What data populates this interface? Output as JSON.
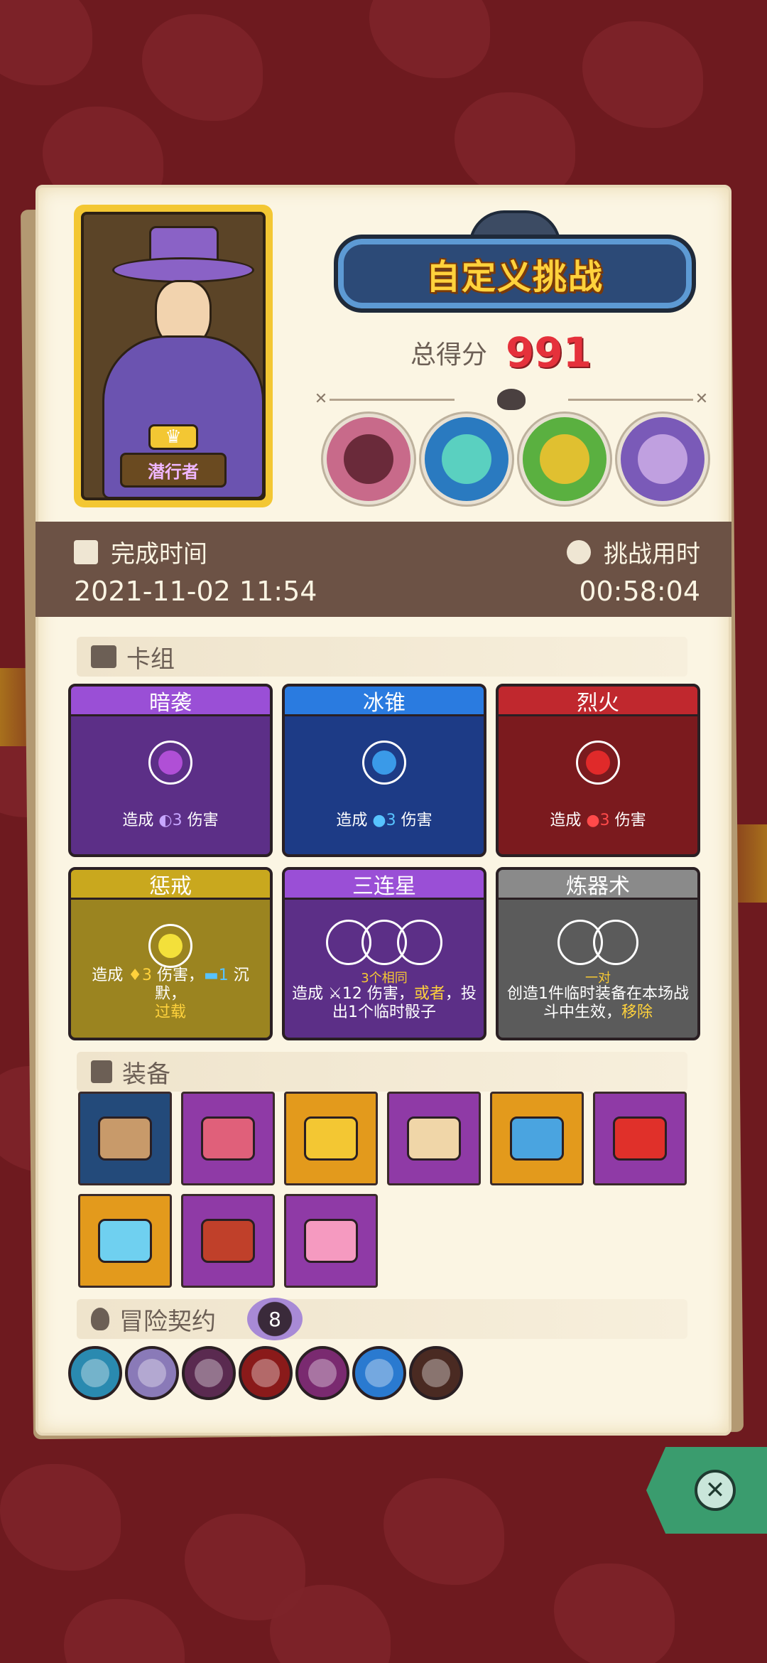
{
  "portrait": {
    "name": "潜行者"
  },
  "header": {
    "title": "自定义挑战",
    "score_label": "总得分",
    "score_value": "991"
  },
  "time": {
    "finish_label": "完成时间",
    "finish_value": "2021-11-02 11:54",
    "duration_label": "挑战用时",
    "duration_value": "00:58:04"
  },
  "deck": {
    "section_label": "卡组",
    "cards": [
      {
        "name": "暗袭",
        "desc_pre": "造成 ",
        "desc_num": "3",
        "desc_post": " 伤害"
      },
      {
        "name": "冰锥",
        "desc_pre": "造成 ",
        "desc_num": "3",
        "desc_post": " 伤害"
      },
      {
        "name": "烈火",
        "desc_pre": "造成 ",
        "desc_num": "3",
        "desc_post": " 伤害"
      },
      {
        "name": "惩戒",
        "desc_pre": "造成 ",
        "desc_num": "3",
        "desc_mid": " 伤害，",
        "desc_num2": "1",
        "desc_mid2": " 沉默，",
        "desc_hl": "过载"
      },
      {
        "name": "三连星",
        "ring_label": "3个相同",
        "desc_pre": "造成 ",
        "desc_num": "12",
        "desc_mid": " 伤害，",
        "desc_hl": "或者",
        "desc_post": "，投出1个临时骰子"
      },
      {
        "name": "炼器术",
        "ring_label": "一对",
        "desc_pre": "创造1件临时装备在本场战斗中生效，",
        "desc_hl": "移除"
      }
    ]
  },
  "equipment": {
    "section_label": "装备",
    "items": [
      {
        "icon": "horn-icon",
        "bg": "#234a7a",
        "color": "#c89a6a"
      },
      {
        "icon": "dripping-slime-icon",
        "bg": "#8f3aa6",
        "color": "#e0607a"
      },
      {
        "icon": "crown-icon",
        "bg": "#e39a1c",
        "color": "#f3c733"
      },
      {
        "icon": "spiked-dice-icon",
        "bg": "#8f3aa6",
        "color": "#f0d6a8"
      },
      {
        "icon": "potion-bottle-icon",
        "bg": "#e39a1c",
        "color": "#4aa4e0"
      },
      {
        "icon": "flaming-dagger-icon",
        "bg": "#8f3aa6",
        "color": "#e0302a"
      },
      {
        "icon": "ice-shield-icon",
        "bg": "#e39a1c",
        "color": "#6fd0f0"
      },
      {
        "icon": "spiked-bracer-icon",
        "bg": "#8f3aa6",
        "color": "#c0402a"
      },
      {
        "icon": "heart-amulet-icon",
        "bg": "#8f3aa6",
        "color": "#f59ac0"
      }
    ]
  },
  "contracts": {
    "section_label": "冒险契约",
    "count": "8",
    "items": [
      {
        "icon": "lightning-contract-icon",
        "color": "#2a8ab0"
      },
      {
        "icon": "swords-contract-icon",
        "color": "#8a7ab8"
      },
      {
        "icon": "fire-burst-contract-icon",
        "color": "#5a2a50"
      },
      {
        "icon": "red-rune-contract-icon",
        "color": "#8a1a1a"
      },
      {
        "icon": "poison-flask-contract-icon",
        "color": "#7a2a70"
      },
      {
        "icon": "vortex-contract-icon",
        "color": "#2a7ad0"
      },
      {
        "icon": "pipe-contract-icon",
        "color": "#4a2a22"
      }
    ]
  },
  "bosses": [
    {
      "icon": "stone-golem-boss-icon",
      "bg": "#c86a8a",
      "core": "#6a2a3a"
    },
    {
      "icon": "ice-king-boss-icon",
      "bg": "#2a7ac0",
      "core": "#5ad0c0"
    },
    {
      "icon": "goblin-king-boss-icon",
      "bg": "#5ab040",
      "core": "#e0c030"
    },
    {
      "icon": "purple-dragon-boss-icon",
      "bg": "#7a5ab8",
      "core": "#c0a0e0"
    }
  ],
  "colors": {
    "purple_card": "#5c2f87",
    "purple_head": "#9a4fd6",
    "blue_card": "#1d3b86",
    "blue_head": "#2a7be0",
    "red_card": "#7b1a1e",
    "red_head": "#c0282e",
    "gold_card": "#9b8420",
    "gold_head": "#c9a81e",
    "gray_card": "#5b5b5b",
    "gray_head": "#8a8a8a"
  }
}
